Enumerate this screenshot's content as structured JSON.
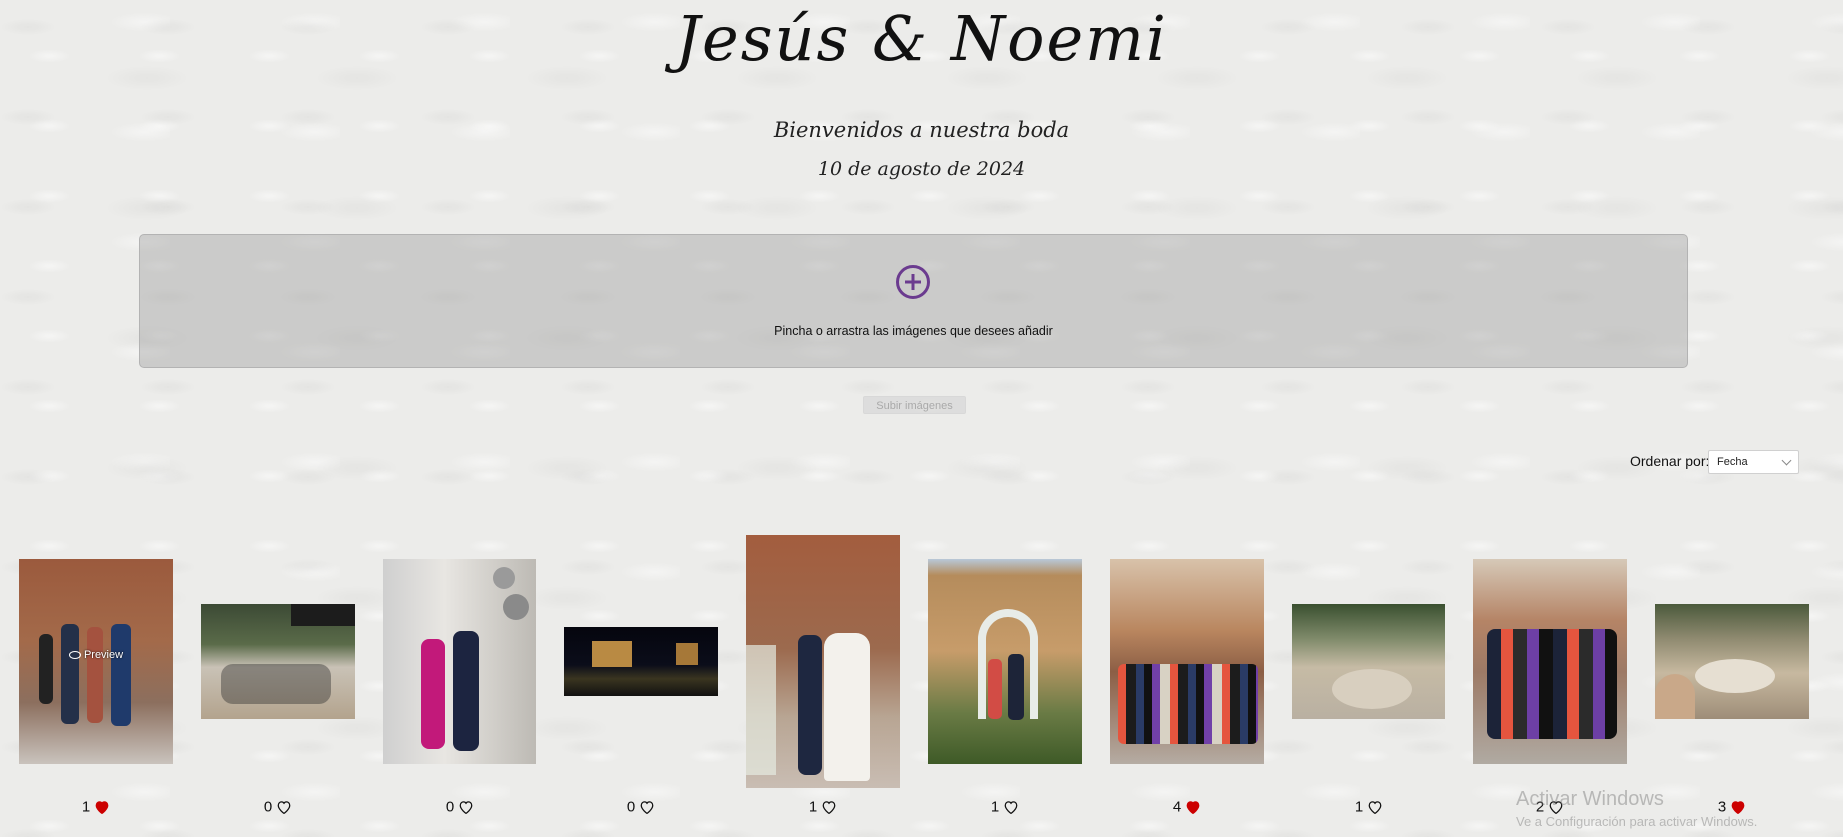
{
  "header": {
    "title": "Jesús & Noemi",
    "welcome": "Bienvenidos a nuestra boda",
    "date": "10 de agosto de 2024"
  },
  "dropzone": {
    "icon": "add-circle-icon",
    "text": "Pincha o arrastra las imágenes que desees añadir"
  },
  "upload": {
    "label": "Subir imágenes"
  },
  "sort": {
    "label": "Ordenar por:",
    "selected": "Fecha"
  },
  "colors": {
    "accent": "#6b3b8f",
    "heart": "#cc0000"
  },
  "gallery": {
    "preview_label": "Preview",
    "photos": [
      {
        "likes": "1",
        "liked": true,
        "icon": "heart-filled-icon"
      },
      {
        "likes": "0",
        "liked": false,
        "icon": "heart-outline-icon"
      },
      {
        "likes": "0",
        "liked": false,
        "icon": "heart-outline-icon"
      },
      {
        "likes": "0",
        "liked": false,
        "icon": "heart-outline-icon"
      },
      {
        "likes": "1",
        "liked": false,
        "icon": "heart-outline-icon"
      },
      {
        "likes": "1",
        "liked": false,
        "icon": "heart-outline-icon"
      },
      {
        "likes": "4",
        "liked": true,
        "icon": "heart-filled-icon"
      },
      {
        "likes": "1",
        "liked": false,
        "icon": "heart-outline-icon"
      },
      {
        "likes": "2",
        "liked": false,
        "icon": "heart-outline-icon"
      },
      {
        "likes": "3",
        "liked": true,
        "icon": "heart-filled-icon"
      }
    ]
  },
  "watermark": {
    "line1": "Activar Windows",
    "line2": "Ve a Configuración para activar Windows."
  }
}
